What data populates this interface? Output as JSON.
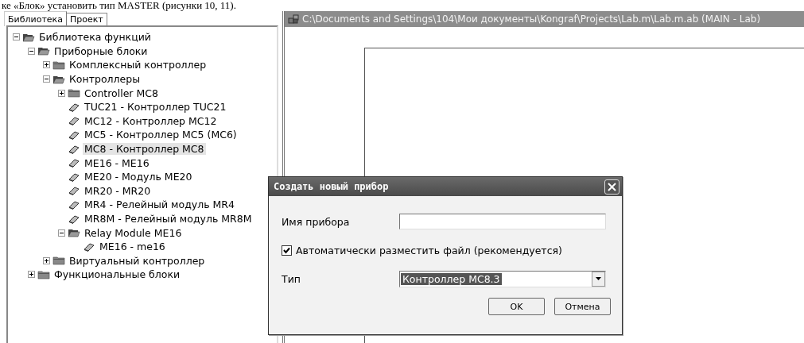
{
  "document_line": "ке «Блок» установить тип MASTER (рисунки 10, 11).",
  "tabs": [
    {
      "label": "Библиотека",
      "selected": true
    },
    {
      "label": "Проект",
      "selected": false
    }
  ],
  "tree": [
    {
      "label": "Библиотека функций",
      "kind": "folder",
      "expanded": true,
      "selected": false,
      "children": [
        {
          "label": "Приборные блоки",
          "kind": "folder",
          "expanded": true,
          "selected": false,
          "children": [
            {
              "label": "Комплексный контроллер",
              "kind": "folder",
              "expanded": false,
              "selected": false
            },
            {
              "label": "Контроллеры",
              "kind": "folder",
              "expanded": true,
              "selected": false,
              "children": [
                {
                  "label": "Controller MC8",
                  "kind": "folder",
                  "expanded": false,
                  "selected": false
                },
                {
                  "label": "TUC21 - Контроллер TUC21",
                  "kind": "device",
                  "selected": false
                },
                {
                  "label": "MC12 - Контроллер MC12",
                  "kind": "device",
                  "selected": false
                },
                {
                  "label": "MC5 - Контроллер MC5 (MC6)",
                  "kind": "device",
                  "selected": false
                },
                {
                  "label": "MC8 - Контроллер MC8",
                  "kind": "device",
                  "selected": true
                },
                {
                  "label": "ME16 - ME16",
                  "kind": "device",
                  "selected": false
                },
                {
                  "label": "ME20 - Модуль ME20",
                  "kind": "device",
                  "selected": false
                },
                {
                  "label": "MR20 - MR20",
                  "kind": "device",
                  "selected": false
                },
                {
                  "label": "MR4 - Релейный модуль MR4",
                  "kind": "device",
                  "selected": false
                },
                {
                  "label": "MR8M - Релейный модуль MR8M",
                  "kind": "device",
                  "selected": false
                },
                {
                  "label": "Relay Module ME16",
                  "kind": "folder",
                  "expanded": true,
                  "selected": false,
                  "children": [
                    {
                      "label": "ME16 - me16",
                      "kind": "device",
                      "selected": false
                    }
                  ]
                }
              ]
            },
            {
              "label": "Виртуальный контроллер",
              "kind": "folder",
              "expanded": false,
              "selected": false
            }
          ]
        },
        {
          "label": "Функциональные блоки",
          "kind": "folder",
          "expanded": false,
          "selected": false
        }
      ]
    }
  ],
  "document_window": {
    "title": "C:\\Documents and Settings\\104\\Мои документы\\Kongraf\\Projects\\Lab.m\\Lab.m.ab (MAIN - Lab)"
  },
  "dialog": {
    "title": "Создать новый прибор",
    "name_label": "Имя прибора",
    "auto_place": {
      "label": "Автоматически разместить файл (рекомендуется)",
      "checked": true
    },
    "type_label": "Тип",
    "type_value": "Контроллер MC8.3",
    "buttons": [
      "OK",
      "Отмена"
    ]
  }
}
